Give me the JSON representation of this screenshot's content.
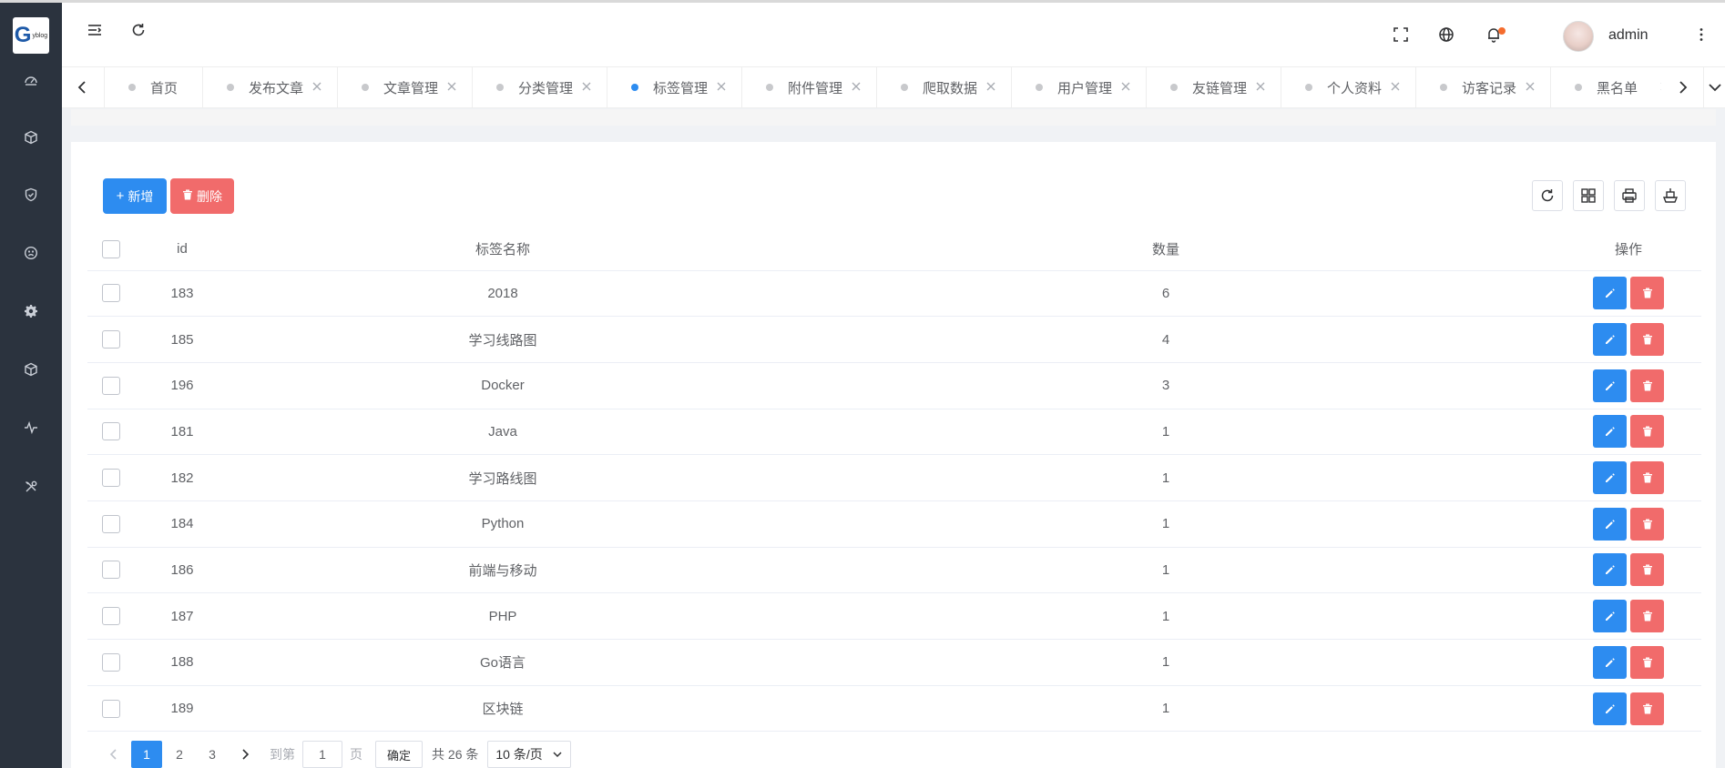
{
  "app": {
    "logo_text": "yblog",
    "logo_mark": "G"
  },
  "header": {
    "username": "admin",
    "icons": [
      "menu-fold-icon",
      "refresh-icon",
      "fullscreen-icon",
      "globe-icon",
      "bell-icon",
      "more-vertical-icon"
    ],
    "notification_dot_color": "#f56c2d"
  },
  "sidebar": {
    "items": [
      {
        "icon": "dashboard-icon"
      },
      {
        "icon": "cube-icon"
      },
      {
        "icon": "shield-check-icon"
      },
      {
        "icon": "frown-icon"
      },
      {
        "icon": "gear-icon"
      },
      {
        "icon": "box-icon"
      },
      {
        "icon": "pulse-icon"
      },
      {
        "icon": "tools-icon"
      }
    ]
  },
  "tabs": [
    {
      "label": "首页",
      "closable": false,
      "active": false
    },
    {
      "label": "发布文章",
      "closable": true,
      "active": false
    },
    {
      "label": "文章管理",
      "closable": true,
      "active": false
    },
    {
      "label": "分类管理",
      "closable": true,
      "active": false
    },
    {
      "label": "标签管理",
      "closable": true,
      "active": true
    },
    {
      "label": "附件管理",
      "closable": true,
      "active": false
    },
    {
      "label": "爬取数据",
      "closable": true,
      "active": false
    },
    {
      "label": "用户管理",
      "closable": true,
      "active": false
    },
    {
      "label": "友链管理",
      "closable": true,
      "active": false
    },
    {
      "label": "个人资料",
      "closable": true,
      "active": false
    },
    {
      "label": "访客记录",
      "closable": true,
      "active": false
    },
    {
      "label": "黑名单",
      "closable": true,
      "active": false
    }
  ],
  "toolbar": {
    "add_label": "新增",
    "delete_label": "删除",
    "tools": [
      "refresh-icon",
      "columns-icon",
      "print-icon",
      "export-icon"
    ]
  },
  "table": {
    "columns": [
      "id",
      "标签名称",
      "数量",
      "操作"
    ],
    "rows": [
      {
        "id": "183",
        "name": "2018",
        "count": "6"
      },
      {
        "id": "185",
        "name": "学习线路图",
        "count": "4"
      },
      {
        "id": "196",
        "name": "Docker",
        "count": "3"
      },
      {
        "id": "181",
        "name": "Java",
        "count": "1"
      },
      {
        "id": "182",
        "name": "学习路线图",
        "count": "1"
      },
      {
        "id": "184",
        "name": "Python",
        "count": "1"
      },
      {
        "id": "186",
        "name": "前端与移动",
        "count": "1"
      },
      {
        "id": "187",
        "name": "PHP",
        "count": "1"
      },
      {
        "id": "188",
        "name": "Go语言",
        "count": "1"
      },
      {
        "id": "189",
        "name": "区块链",
        "count": "1"
      }
    ]
  },
  "pagination": {
    "pages": [
      "1",
      "2",
      "3"
    ],
    "current": "1",
    "goto_label": "到第",
    "goto_value": "1",
    "page_unit": "页",
    "confirm_label": "确定",
    "total_label": "共 26 条",
    "page_size_label": "10 条/页"
  },
  "colors": {
    "primary": "#2d8cf0",
    "danger": "#f16b6b",
    "sidebar_bg": "#2b333e"
  }
}
